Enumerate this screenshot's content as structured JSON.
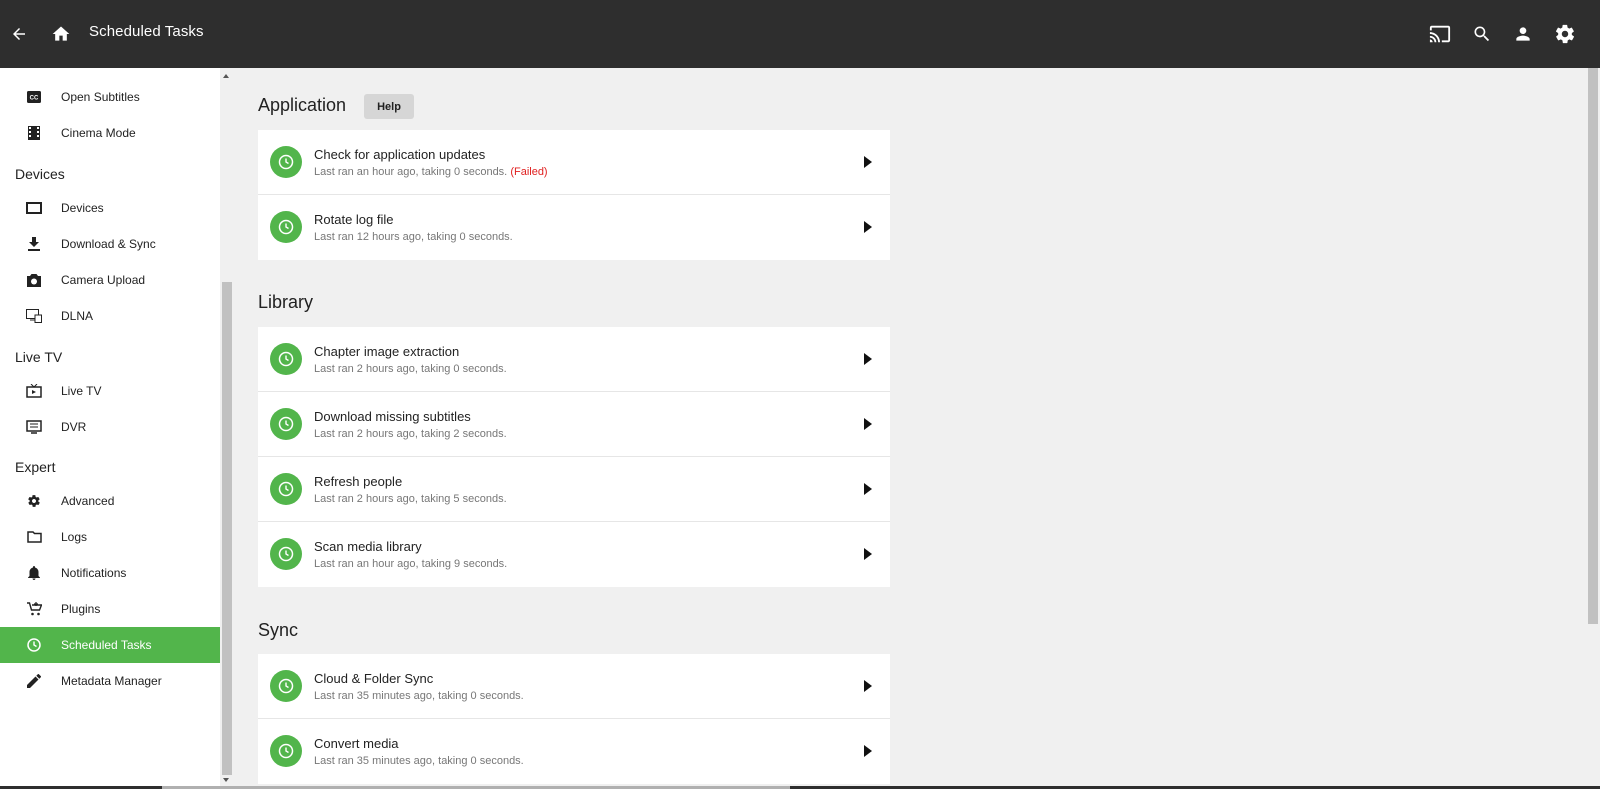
{
  "header": {
    "title": "Scheduled Tasks",
    "icons": [
      "back-arrow-icon",
      "home-icon",
      "cast-icon",
      "search-icon",
      "user-icon",
      "settings-icon"
    ]
  },
  "sidebar": {
    "items_top": [
      {
        "label": "Open Subtitles",
        "icon": "closed-captions-icon"
      },
      {
        "label": "Cinema Mode",
        "icon": "film-icon"
      }
    ],
    "sections": [
      {
        "title": "Devices",
        "items": [
          {
            "label": "Devices",
            "icon": "tablet-icon"
          },
          {
            "label": "Download & Sync",
            "icon": "download-icon"
          },
          {
            "label": "Camera Upload",
            "icon": "camera-icon"
          },
          {
            "label": "DLNA",
            "icon": "dlna-icon"
          }
        ]
      },
      {
        "title": "Live TV",
        "items": [
          {
            "label": "Live TV",
            "icon": "live-tv-icon"
          },
          {
            "label": "DVR",
            "icon": "dvr-icon"
          }
        ]
      },
      {
        "title": "Expert",
        "items": [
          {
            "label": "Advanced",
            "icon": "gear-icon"
          },
          {
            "label": "Logs",
            "icon": "folder-icon"
          },
          {
            "label": "Notifications",
            "icon": "bell-icon"
          },
          {
            "label": "Plugins",
            "icon": "cart-icon"
          },
          {
            "label": "Scheduled Tasks",
            "icon": "clock-icon",
            "active": true
          },
          {
            "label": "Metadata Manager",
            "icon": "pencil-icon"
          }
        ]
      }
    ]
  },
  "main": {
    "help_label": "Help",
    "groups": [
      {
        "title": "Application",
        "tasks": [
          {
            "name": "Check for application updates",
            "desc": "Last ran an hour ago, taking 0 seconds.",
            "status": "(Failed)"
          },
          {
            "name": "Rotate log file",
            "desc": "Last ran 12 hours ago, taking 0 seconds."
          }
        ]
      },
      {
        "title": "Library",
        "tasks": [
          {
            "name": "Chapter image extraction",
            "desc": "Last ran 2 hours ago, taking 0 seconds."
          },
          {
            "name": "Download missing subtitles",
            "desc": "Last ran 2 hours ago, taking 2 seconds."
          },
          {
            "name": "Refresh people",
            "desc": "Last ran 2 hours ago, taking 5 seconds."
          },
          {
            "name": "Scan media library",
            "desc": "Last ran an hour ago, taking 9 seconds."
          }
        ]
      },
      {
        "title": "Sync",
        "tasks": [
          {
            "name": "Cloud & Folder Sync",
            "desc": "Last ran 35 minutes ago, taking 0 seconds."
          },
          {
            "name": "Convert media",
            "desc": "Last ran 35 minutes ago, taking 0 seconds."
          }
        ]
      }
    ]
  },
  "colors": {
    "accent": "#52b54b",
    "header_bg": "#2e2e2e",
    "failed": "#e02020"
  }
}
